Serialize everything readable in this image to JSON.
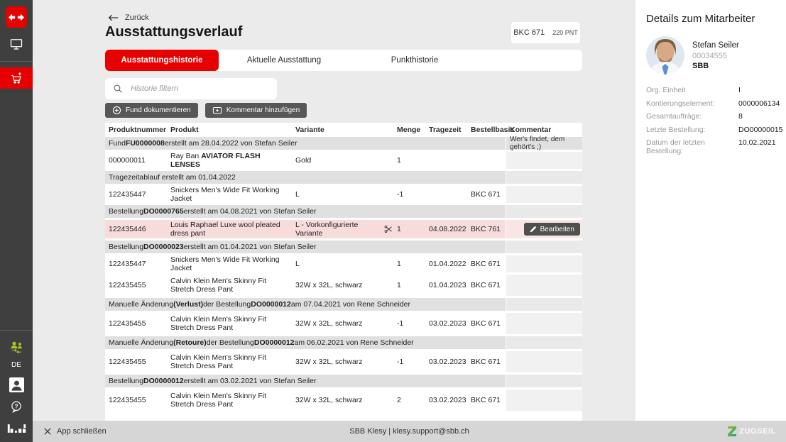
{
  "sidebar": {
    "language": "DE",
    "icons": [
      "sbb-logo-icon",
      "monitor-icon",
      "cart-plus-icon",
      "users-switch-icon",
      "portrait-icon",
      "help-icon",
      "bp-logo-icon"
    ]
  },
  "header": {
    "back_label": "Zurück",
    "title": "Ausstattungsverlauf",
    "badge": {
      "bkc": "BKC 671",
      "points": "220 PNT"
    }
  },
  "tabs": [
    {
      "label": "Ausstattungshistorie",
      "active": true
    },
    {
      "label": "Aktuelle Ausstattung",
      "active": false
    },
    {
      "label": "Punkthistorie",
      "active": false
    }
  ],
  "search": {
    "placeholder": "Historie filtern"
  },
  "actions": [
    {
      "label": "Fund dokumentieren",
      "icon": "plus-circle-icon"
    },
    {
      "label": "Kommentar hinzufügen",
      "icon": "comment-add-icon"
    }
  ],
  "table": {
    "columns": [
      "Produktnummer",
      "Produkt",
      "Variante",
      "Menge",
      "Tragezeit",
      "Bestellbasis",
      "Kommentar"
    ],
    "rows": [
      {
        "type": "group",
        "parts": [
          {
            "t": "Fund "
          },
          {
            "t": "FU0000008",
            "b": true
          },
          {
            "t": " erstellt am 28.04.2022 von Stefan Seiler"
          }
        ],
        "comment": "Wer's findet, dem gehört's ;)"
      },
      {
        "type": "item",
        "size": "single",
        "produktnummer": "000000011",
        "produkt": [
          {
            "t": "Ray Ban "
          },
          {
            "t": "AVIATOR FLASH LENSES",
            "b": true
          }
        ],
        "variante": "Gold",
        "menge": "1",
        "tragezeit": "",
        "bestellbasis": ""
      },
      {
        "type": "group",
        "parts": [
          {
            "t": "Tragezeitablauf erstellt am 01.04.2022"
          }
        ]
      },
      {
        "type": "item",
        "size": "single",
        "produktnummer": "122435447",
        "produkt": [
          {
            "t": "Snickers Men's Wide Fit Working Jacket"
          }
        ],
        "variante": "L",
        "menge": "-1",
        "tragezeit": "",
        "bestellbasis": "BKC 671"
      },
      {
        "type": "group",
        "parts": [
          {
            "t": "Bestellung "
          },
          {
            "t": "DO0000765",
            "b": true
          },
          {
            "t": " erstellt am 04.08.2021 von Stefan Seiler"
          }
        ]
      },
      {
        "type": "item",
        "size": "pink",
        "highlight": true,
        "produktnummer": "122435446",
        "produkt": [
          {
            "t": "Louis Raphael Luxe wool pleated dress pant"
          }
        ],
        "variante": "L - Vorkonfigurierte Variante",
        "scissors": true,
        "menge": "1",
        "tragezeit": "04.08.2022",
        "bestellbasis": "BKC 761",
        "action": "Bearbeiten"
      },
      {
        "type": "group",
        "parts": [
          {
            "t": "Bestellung "
          },
          {
            "t": "DO0000023",
            "b": true
          },
          {
            "t": " erstellt am 01.04.2021 von Stefan Seiler"
          }
        ]
      },
      {
        "type": "item",
        "size": "single",
        "produktnummer": "122435447",
        "produkt": [
          {
            "t": "Snickers Men's Wide Fit Working Jacket"
          }
        ],
        "variante": "L",
        "menge": "1",
        "tragezeit": "01.04.2022",
        "bestellbasis": "BKC 671"
      },
      {
        "type": "item",
        "size": "double",
        "produktnummer": "122435455",
        "produkt": [
          {
            "t": "Calvin Klein Men's Skinny Fit Stretch Dress Pant"
          }
        ],
        "variante": "32W x 32L, schwarz",
        "menge": "1",
        "tragezeit": "01.04.2023",
        "bestellbasis": "BKC 671"
      },
      {
        "type": "group",
        "parts": [
          {
            "t": "Manuelle Änderung "
          },
          {
            "t": "(Verlust)",
            "b": true
          },
          {
            "t": " der Bestellung "
          },
          {
            "t": "DO0000012",
            "b": true
          },
          {
            "t": " am 07.04.2021 von Rene Schneider"
          }
        ]
      },
      {
        "type": "item",
        "size": "double",
        "produktnummer": "122435455",
        "produkt": [
          {
            "t": "Calvin Klein Men's Skinny Fit Stretch Dress Pant"
          }
        ],
        "variante": "32W x 32L, schwarz",
        "menge": "-1",
        "tragezeit": "03.02.2023",
        "bestellbasis": "BKC 671"
      },
      {
        "type": "group",
        "parts": [
          {
            "t": "Manuelle Änderung "
          },
          {
            "t": "(Retoure)",
            "b": true
          },
          {
            "t": " der Bestellung "
          },
          {
            "t": "DO0000012",
            "b": true
          },
          {
            "t": " am 06.02.2021 von Rene Schneider"
          }
        ]
      },
      {
        "type": "item",
        "size": "double",
        "produktnummer": "122435455",
        "produkt": [
          {
            "t": "Calvin Klein Men's Skinny Fit Stretch Dress Pant"
          }
        ],
        "variante": "32W x 32L, schwarz",
        "menge": "-1",
        "tragezeit": "03.02.2023",
        "bestellbasis": "BKC 671"
      },
      {
        "type": "group",
        "parts": [
          {
            "t": "Bestellung "
          },
          {
            "t": "DO0000012",
            "b": true
          },
          {
            "t": " erstellt am 03.02.2021 von Stefan Seiler"
          }
        ]
      },
      {
        "type": "item",
        "size": "double",
        "produktnummer": "122435455",
        "produkt": [
          {
            "t": "Calvin Klein Men's Skinny Fit Stretch Dress Pant"
          }
        ],
        "variante": "32W x 32L, schwarz",
        "menge": "2",
        "tragezeit": "03.02.2023",
        "bestellbasis": "BKC 671"
      }
    ]
  },
  "details": {
    "title": "Details zum Mitarbeiter",
    "name": "Stefan Seiler",
    "employee_id": "00034555",
    "company": "SBB",
    "fields": [
      {
        "label": "Org. Einheit",
        "value": "I"
      },
      {
        "label": "Kontierungselement:",
        "value": "0000006134"
      },
      {
        "label": "Gesamtaufträge:",
        "value": "8"
      },
      {
        "label": "Letzte Bestellung:",
        "value": "DO00000015"
      },
      {
        "label": "Datum der letzten Bestellung:",
        "value": "10.02.2021"
      }
    ]
  },
  "footer": {
    "close_label": "App schließen",
    "support": "SBB Klesy | klesy.support@sbb.ch",
    "brand": "ZUGSEIL"
  },
  "colors": {
    "accent_red": "#e60000",
    "sidebar_bg": "#3f3f3f",
    "highlight_row": "#f8dbdb",
    "users_icon_green": "#a9c325",
    "footer_bg": "#d6d6d6"
  }
}
